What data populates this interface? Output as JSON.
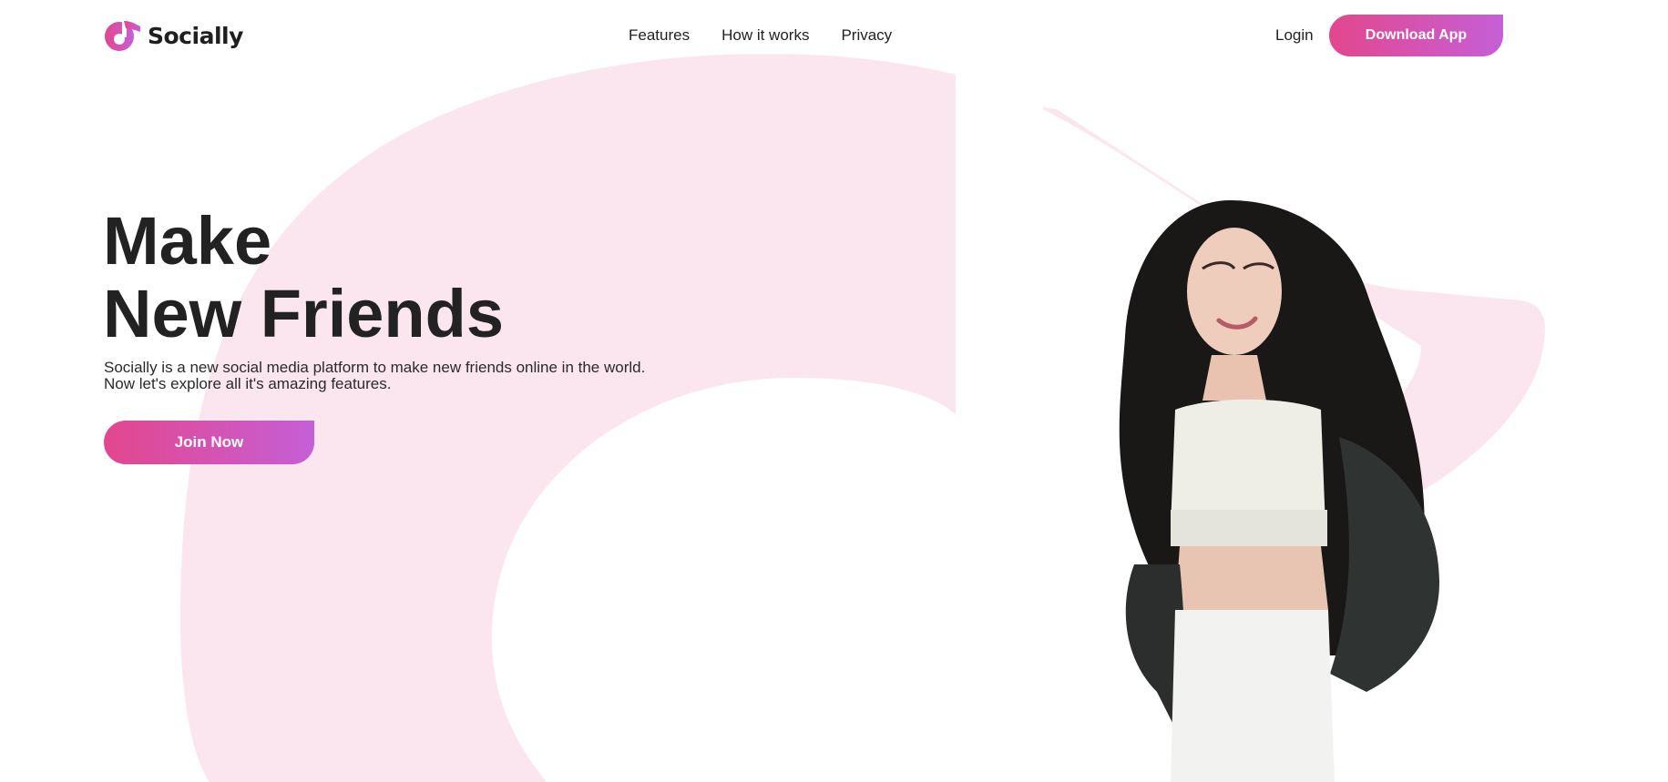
{
  "header": {
    "logo_text": "Socially",
    "logo_icon": "music-note-logo",
    "nav": [
      {
        "label": "Features"
      },
      {
        "label": "How it works"
      },
      {
        "label": "Privacy"
      }
    ],
    "login_label": "Login",
    "download_label": "Download App"
  },
  "hero": {
    "title_line1": "Make",
    "title_line2": "New Friends",
    "description": "Socially is a new social media platform to make new friends online in the world. Now let's explore all it's amazing features.",
    "cta_label": "Join Now"
  },
  "colors": {
    "accent_start": "#e3478d",
    "accent_end": "#c55fd6",
    "background_shape": "#fbe6ef",
    "text": "#222222"
  }
}
